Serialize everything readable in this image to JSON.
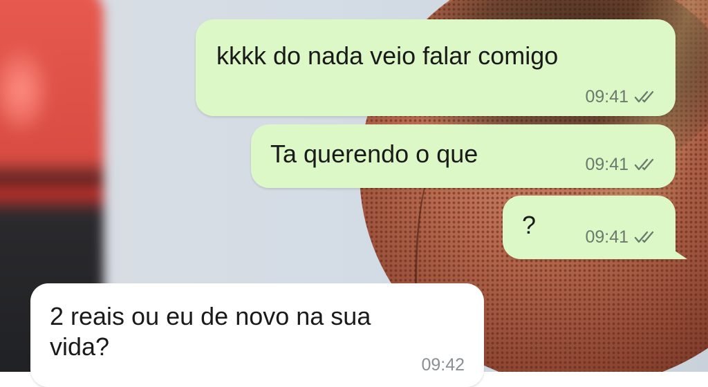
{
  "chat": {
    "messages": [
      {
        "direction": "outgoing",
        "text": "kkkk do nada veio falar comigo",
        "time": "09:41",
        "status_icon": "double-check-icon"
      },
      {
        "direction": "outgoing",
        "text": "Ta querendo o que",
        "time": "09:41",
        "status_icon": "double-check-icon"
      },
      {
        "direction": "outgoing",
        "text": "?",
        "time": "09:41",
        "status_icon": "double-check-icon"
      },
      {
        "direction": "incoming",
        "text_lines": [
          "2 reais ou eu de novo na sua",
          "vida?"
        ],
        "time": "09:42"
      }
    ]
  },
  "colors": {
    "outgoing_bubble": "#dcf8c6",
    "incoming_bubble": "#ffffff",
    "timestamp": "#6c7a6e"
  }
}
